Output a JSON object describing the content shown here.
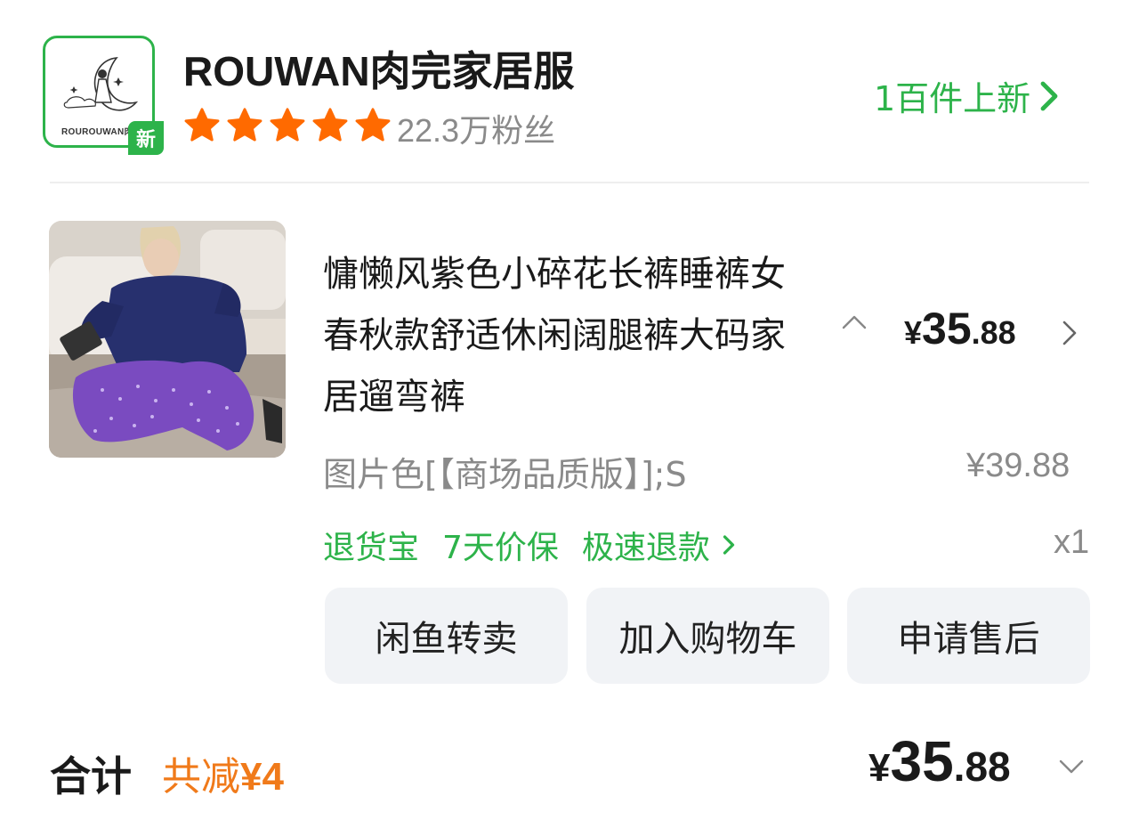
{
  "shop": {
    "logo_text": "ROUROUWAN肉",
    "new_badge": "新",
    "name": "ROUWAN肉完家居服",
    "rating_stars": 5,
    "fans": "22.3万粉丝",
    "new_items": "1百件上新"
  },
  "product": {
    "title": "慵懒风紫色小碎花长裤睡裤女春秋款舒适休闲阔腿裤大码家居遛弯裤",
    "price_symbol": "¥",
    "price_int": "35",
    "price_dec": ".88",
    "spec": "图片色[【商场品质版】];S",
    "original_price": "¥39.88",
    "services": [
      "退货宝",
      "7天价保",
      "极速退款"
    ],
    "quantity": "x1"
  },
  "actions": {
    "resell": "闲鱼转卖",
    "add_cart": "加入购物车",
    "after_sale": "申请售后"
  },
  "total": {
    "label": "合计",
    "saved_prefix": "共减",
    "saved_amount": "¥4",
    "price_symbol": "¥",
    "price_int": "35",
    "price_dec": ".88"
  },
  "colors": {
    "brand_green": "#2db34a",
    "star_orange": "#ff6a00",
    "discount_orange": "#f07a1a"
  }
}
